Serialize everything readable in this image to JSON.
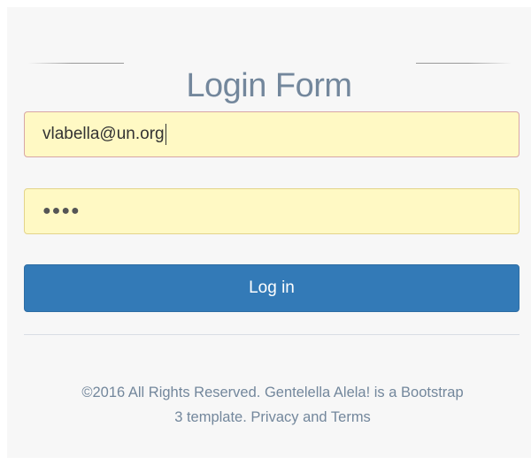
{
  "header": {
    "title": "Login Form"
  },
  "form": {
    "email_value": "vlabella@un.org",
    "password_mask": "●●●●",
    "login_label": "Log in"
  },
  "footer": {
    "line1": "©2016 All Rights Reserved. Gentelella Alela! is a Bootstrap",
    "line2": "3 template. Privacy and Terms"
  },
  "colors": {
    "title": "#73879c",
    "field_background": "#fff9c4",
    "button_primary": "#337ab7",
    "page_background": "#f7f7f7"
  },
  "icons": {
    "caret": "text-caret-icon"
  }
}
